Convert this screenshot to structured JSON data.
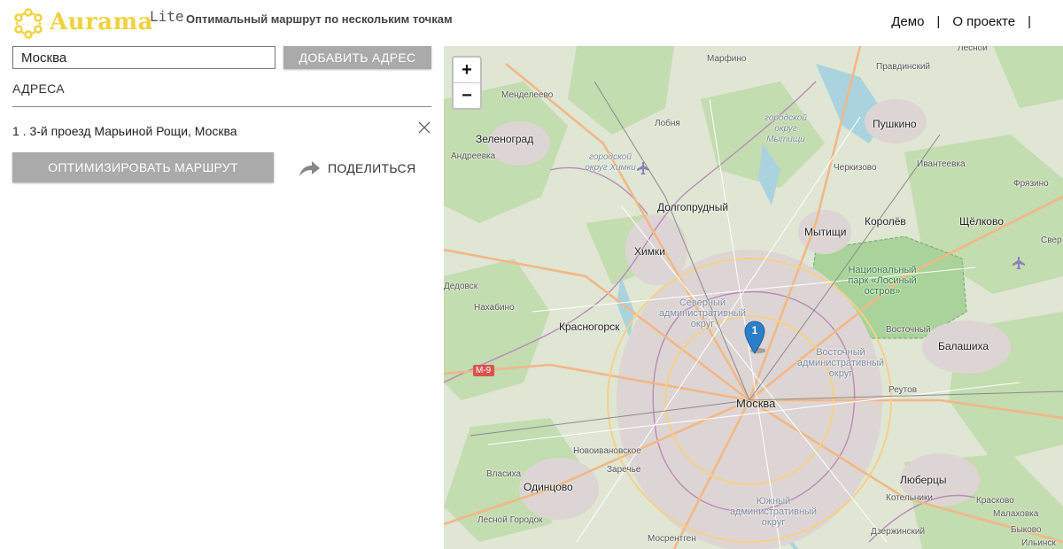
{
  "header": {
    "brand": "Aurama",
    "edition": "Lite",
    "tagline": "Оптимальный маршрут по нескольким точкам",
    "nav": [
      {
        "label": "Демо"
      },
      {
        "label": "О проекте"
      }
    ],
    "separator": "|"
  },
  "form": {
    "address_value": "Москва",
    "add_button": "ДОБАВИТЬ АДРЕС"
  },
  "addresses": {
    "heading": "АДРЕСА",
    "items": [
      {
        "label": "1 . 3-й проезд Марьиной Рощи, Москва"
      }
    ]
  },
  "actions": {
    "optimize": "ОПТИМИЗИРОВАТЬ МАРШРУТ",
    "share": "ПОДЕЛИТЬСЯ"
  },
  "map": {
    "zoom_in": "+",
    "zoom_out": "−",
    "marker_number": "1",
    "labels": {
      "marfino": "Марфино",
      "pravdinsky": "Правдинский",
      "lesnoy": "Лесной",
      "mendeleevo": "Менделеево",
      "lobnya": "Лобня",
      "mytishchi_okrug": "городской округ Мытищи",
      "pushkino": "Пушкино",
      "zelenograd": "Зеленоград",
      "andreevka": "Андреевка",
      "khimki_okrug": "городской округ Химки",
      "cherkizovo": "Черкизово",
      "ivanteevka": "Ивантеевка",
      "fryazino": "Фрязино",
      "dolgoprudny": "Долгопрудный",
      "korolev": "Королёв",
      "shchelkovo": "Щёлково",
      "mytishchi": "Мытищи",
      "sver": "Свер",
      "khimki": "Химки",
      "national_park": "Национальный парк «Лосиный остров»",
      "dedovsk": "Дедовск",
      "nakhabino": "Нахабино",
      "severny": "Северный административный округ",
      "krasnogorsk": "Красногорск",
      "vostochny": "Восточный",
      "balashikha": "Балашиха",
      "vostochny_okrug": "Восточный административный округ",
      "m9": "М-9",
      "reutov": "Реутов",
      "moscow": "Москва",
      "novoivanovskoe": "Новоивановское",
      "zarechye": "Заречье",
      "vlasikha": "Власиха",
      "odintsovo": "Одинцово",
      "lyubertsy": "Люберцы",
      "kotelniki": "Котельники",
      "krasnovo": "Красково",
      "malakhovka": "Малаховка",
      "yuzhny_okrug": "Южный административный округ",
      "lesnoy_gorodok": "Лесной Городок",
      "mosrentgen": "Мосрентген",
      "dzerzhinsky": "Дзержинский",
      "bykovo": "Быково",
      "ilyinskoe": "Ильинск"
    }
  },
  "colors": {
    "brand": "#f1d23c",
    "button": "#aaaaaa",
    "marker": "#2c7ec8"
  }
}
